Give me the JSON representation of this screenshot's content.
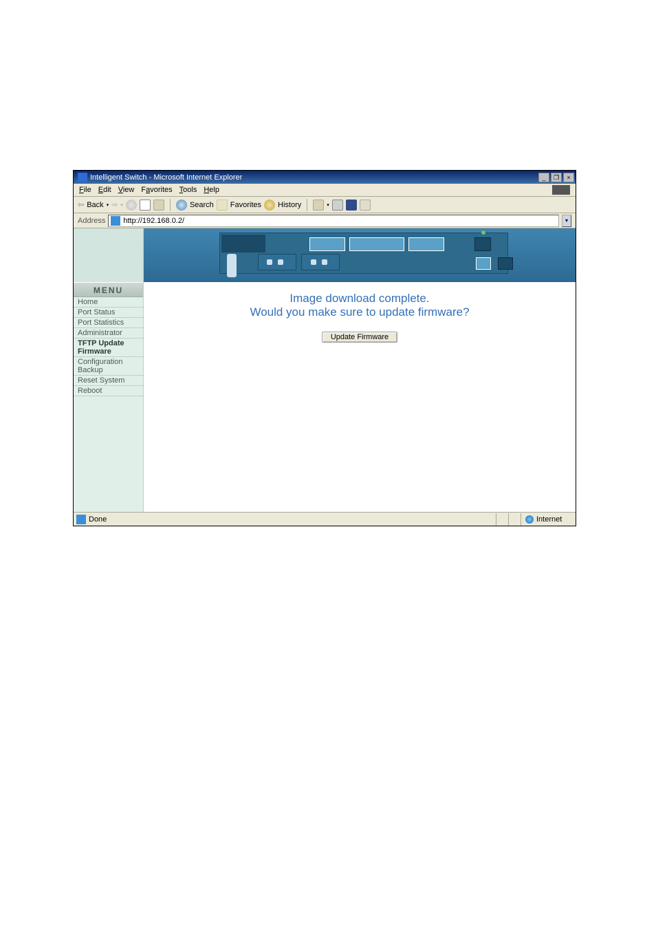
{
  "window": {
    "title": "Intelligent Switch - Microsoft Internet Explorer",
    "minimize": "_",
    "restore": "❐",
    "close": "×"
  },
  "menubar": {
    "file": "File",
    "edit": "Edit",
    "view": "View",
    "favorites": "Favorites",
    "tools": "Tools",
    "help": "Help"
  },
  "toolbar": {
    "back": "Back",
    "search": "Search",
    "favorites": "Favorites",
    "history": "History"
  },
  "addressbar": {
    "label": "Address",
    "url": "http://192.168.0.2/"
  },
  "sidebar": {
    "header": "MENU",
    "items": [
      {
        "label": "Home"
      },
      {
        "label": "Port Status"
      },
      {
        "label": "Port Statistics"
      },
      {
        "label": "Administrator"
      },
      {
        "label": "TFTP Update Firmware",
        "active": true
      },
      {
        "label": "Configuration Backup"
      },
      {
        "label": "Reset System"
      },
      {
        "label": "Reboot"
      }
    ]
  },
  "firmware": {
    "line1": "Image download complete.",
    "line2": "Would you make sure to update firmware?",
    "button": "Update Firmware"
  },
  "statusbar": {
    "done": "Done",
    "zone": "Internet"
  }
}
